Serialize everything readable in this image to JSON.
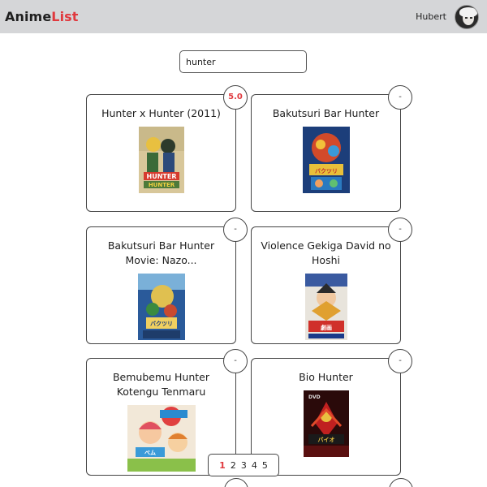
{
  "header": {
    "logo_part1": "Anime",
    "logo_part2": "List",
    "user_name": "Hubert"
  },
  "search": {
    "value": "hunter"
  },
  "results": [
    {
      "title": "Hunter x Hunter (2011)",
      "rating": "5.0"
    },
    {
      "title": "Bakutsuri Bar Hunter",
      "rating": "-"
    },
    {
      "title": "Bakutsuri Bar Hunter Movie: Nazo...",
      "rating": "-"
    },
    {
      "title": "Violence Gekiga David no Hoshi",
      "rating": "-"
    },
    {
      "title": "Bemubemu Hunter Kotengu Tenmaru",
      "rating": "-"
    },
    {
      "title": "Bio Hunter",
      "rating": "-"
    }
  ],
  "pagination": {
    "pages": [
      "1",
      "2",
      "3",
      "4",
      "5"
    ],
    "current": "1"
  },
  "colors": {
    "accent": "#e0393e",
    "header_bg": "#d5d6d8"
  }
}
